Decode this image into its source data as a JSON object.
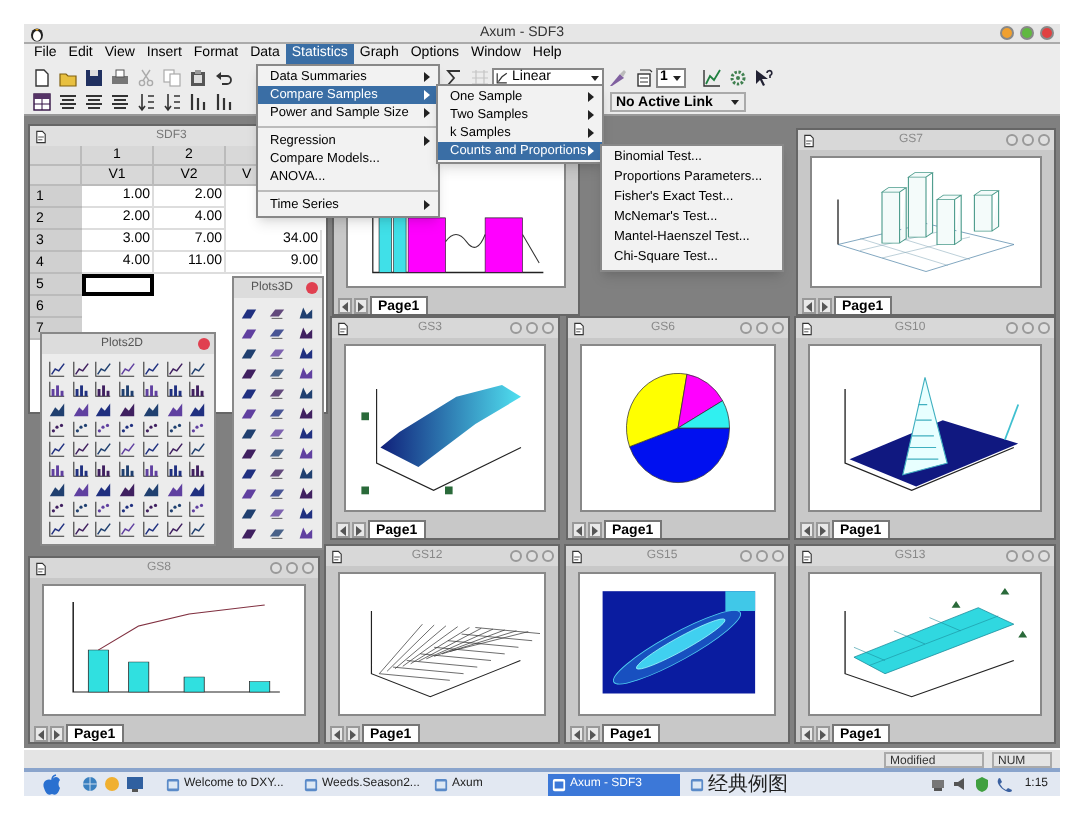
{
  "window": {
    "title": "Axum - SDF3"
  },
  "menu_bar": [
    {
      "label": "File",
      "selected": false
    },
    {
      "label": "Edit",
      "selected": false
    },
    {
      "label": "View",
      "selected": false
    },
    {
      "label": "Insert",
      "selected": false
    },
    {
      "label": "Format",
      "selected": false
    },
    {
      "label": "Data",
      "selected": false
    },
    {
      "label": "Statistics",
      "selected": true
    },
    {
      "label": "Graph",
      "selected": false
    },
    {
      "label": "Options",
      "selected": false
    },
    {
      "label": "Window",
      "selected": false
    },
    {
      "label": "Help",
      "selected": false
    }
  ],
  "toolbar": {
    "scale": "Linear",
    "page": "1",
    "link": "No Active Link"
  },
  "statistics_menu": [
    {
      "kind": "submenu",
      "label": "Data Summaries",
      "selected": false
    },
    {
      "kind": "submenu",
      "label": "Compare Samples",
      "selected": true
    },
    {
      "kind": "submenu",
      "label": "Power and Sample Size",
      "selected": false
    },
    {
      "kind": "separator"
    },
    {
      "kind": "submenu",
      "label": "Regression",
      "selected": false
    },
    {
      "kind": "command",
      "label": "Compare Models...",
      "selected": false
    },
    {
      "kind": "command",
      "label": "ANOVA...",
      "selected": false
    },
    {
      "kind": "separator"
    },
    {
      "kind": "submenu",
      "label": "Time Series",
      "selected": false
    }
  ],
  "compare_samples_menu": [
    {
      "kind": "submenu",
      "label": "One Sample",
      "selected": false
    },
    {
      "kind": "submenu",
      "label": "Two Samples",
      "selected": false
    },
    {
      "kind": "submenu",
      "label": "k Samples",
      "selected": false
    },
    {
      "kind": "submenu",
      "label": "Counts and Proportions",
      "selected": true
    }
  ],
  "counts_and_proportions_menu": [
    {
      "kind": "command",
      "label": "Binomial Test...",
      "selected": false
    },
    {
      "kind": "command",
      "label": "Proportions Parameters...",
      "selected": false
    },
    {
      "kind": "command",
      "label": "Fisher's Exact Test...",
      "selected": false
    },
    {
      "kind": "command",
      "label": "McNemar's Test...",
      "selected": false
    },
    {
      "kind": "command",
      "label": "Mantel-Haenszel Test...",
      "selected": false
    },
    {
      "kind": "command",
      "label": "Chi-Square Test...",
      "selected": false
    }
  ],
  "data_window": {
    "title": "SDF3",
    "columns": [
      {
        "number": "1",
        "name": "V1"
      },
      {
        "number": "2",
        "name": "V2"
      },
      {
        "name": "V"
      }
    ],
    "rows": [
      {
        "label": "1",
        "cells": [
          {
            "value": "1.00",
            "selected": false
          },
          {
            "value": "2.00",
            "selected": false
          }
        ]
      },
      {
        "label": "2",
        "cells": [
          {
            "value": "2.00",
            "selected": false
          },
          {
            "value": "4.00",
            "selected": false
          }
        ]
      },
      {
        "label": "3",
        "cells": [
          {
            "value": "3.00",
            "selected": false
          },
          {
            "value": "7.00",
            "selected": false
          },
          {
            "value": "34.00",
            "selected": false
          }
        ]
      },
      {
        "label": "4",
        "cells": [
          {
            "value": "4.00",
            "selected": false
          },
          {
            "value": "11.00",
            "selected": false
          },
          {
            "value": "9.00",
            "selected": false
          }
        ]
      },
      {
        "label": "5",
        "cells": [
          {
            "selected": true
          }
        ]
      },
      {
        "label": "6",
        "cells": []
      },
      {
        "label": "7",
        "cells": []
      }
    ]
  },
  "graph_windows": [
    {
      "kind": "bars_line",
      "tab": "Page1"
    },
    {
      "title": "GS7",
      "kind": "bars3d",
      "tab": "Page1"
    },
    {
      "title": "GS3",
      "kind": "surface",
      "tab": "Page1"
    },
    {
      "title": "GS6",
      "kind": "pie",
      "tab": "Page1"
    },
    {
      "title": "GS10",
      "kind": "spike",
      "tab": "Page1"
    },
    {
      "title": "GS8",
      "kind": "pareto",
      "tab": "Page1"
    },
    {
      "title": "GS12",
      "kind": "mesh",
      "tab": "Page1"
    },
    {
      "title": "GS15",
      "kind": "contour",
      "tab": "Page1"
    },
    {
      "title": "GS13",
      "kind": "plane",
      "tab": "Page1"
    }
  ],
  "palettes": [
    {
      "title": "Plots2D",
      "kind": "plots2d"
    },
    {
      "title": "Plots3D",
      "kind": "plots3d"
    }
  ],
  "status_bar": [
    "Modified",
    "NUM"
  ],
  "taskbar": {
    "items": [
      {
        "label": "Welcome to DXY...",
        "selected": false
      },
      {
        "label": "Weeds.Season2...",
        "selected": false
      },
      {
        "label": "Axum",
        "selected": false
      },
      {
        "label": "Axum - SDF3",
        "selected": true
      },
      {
        "label": "经典例图",
        "selected": false
      }
    ],
    "clock": "1:15"
  }
}
